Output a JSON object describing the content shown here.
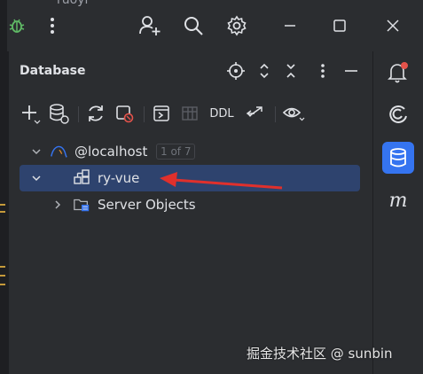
{
  "titlebar": {
    "project_fragment": "ruoyi",
    "icons": [
      "bug-icon",
      "more-vertical-icon",
      "add-user-icon",
      "search-icon",
      "settings-icon",
      "minimize-icon",
      "maximize-icon",
      "close-icon"
    ]
  },
  "panel": {
    "title": "Database",
    "header_icons": [
      "crosshair-icon",
      "expand-icon",
      "collapse-icon",
      "more-vertical-icon",
      "hide-icon"
    ]
  },
  "toolbar": {
    "ddl_label": "DDL",
    "icons": [
      "add-icon",
      "data-source-icon",
      "refresh-icon",
      "stop-icon",
      "console-icon",
      "table-icon",
      "ddl-button",
      "compare-icon",
      "view-icon"
    ]
  },
  "tree": {
    "root": {
      "label": "@localhost",
      "badge": "1 of 7",
      "expanded": true
    },
    "schema": {
      "label": "ry-vue",
      "expanded": true,
      "selected": true
    },
    "server_objects": {
      "label": "Server Objects",
      "expanded": false
    }
  },
  "rightbar": {
    "icons": [
      "notifications-icon",
      "ai-assistant-icon",
      "database-icon",
      "maven-icon"
    ],
    "maven_label": "m",
    "notification_color": "#e5534b",
    "active_color": "#3574f0"
  },
  "annotation": {
    "arrow_color": "#e0302c"
  },
  "watermark": "掘金技术社区 @ sunbin"
}
